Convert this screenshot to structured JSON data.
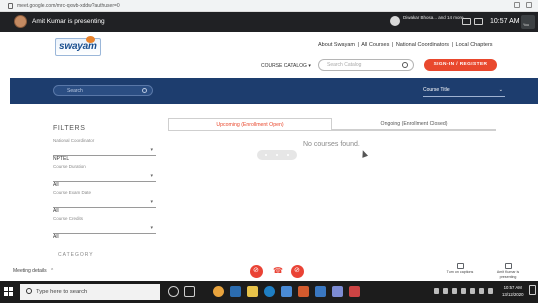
{
  "browser": {
    "url": "meet.google.com/mrc-qxwb-xddw?authuser=0"
  },
  "meet_top": {
    "presenter_text": "Amit Kumar is presenting",
    "other_participant": "Diwakar Bhosa... and 14 more",
    "clock": "10:57 AM",
    "you_label": "You"
  },
  "site": {
    "logo_text": "swayam",
    "top_links": [
      "About Swayam",
      "All Courses",
      "National Coordinators",
      "Local Chapters"
    ],
    "link_separator": "|",
    "course_catalog": "COURSE CATALOG",
    "catalog_search_placeholder": "Search Catalog",
    "signin_label": "SIGN-IN / REGISTER"
  },
  "search_band": {
    "search_placeholder": "Search",
    "sort_label": "Course Title"
  },
  "filters": {
    "title": "FILTERS",
    "groups": [
      {
        "label": "National Coordinator",
        "value": "NPTEL"
      },
      {
        "label": "Course Duration",
        "value": "All"
      },
      {
        "label": "Course Exam Date",
        "value": "All"
      },
      {
        "label": "Course Credits",
        "value": "All"
      }
    ],
    "category_title": "CATEGORY"
  },
  "tabs": {
    "upcoming": "Upcoming (Enrollment Open)",
    "ongoing": "Ongoing (Enrollment Closed)"
  },
  "results": {
    "empty_message": "No courses found."
  },
  "meet_bottom": {
    "meeting_details": "Meeting details",
    "everyone_label": "Turn on captions",
    "presenting_label": "Amit Kumar is presenting"
  },
  "taskbar": {
    "search_placeholder": "Type here to search",
    "time": "10:57 AM",
    "date": "13/12/2020"
  },
  "colors": {
    "accent": "#e9482d",
    "band": "#1d3d6e",
    "meet_bar": "#202124",
    "call_red": "#ea4335",
    "taskbar": "#1c1c1c"
  }
}
